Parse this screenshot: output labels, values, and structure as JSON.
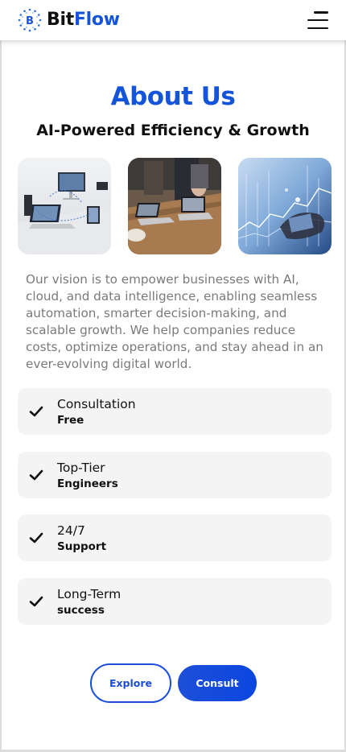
{
  "header": {
    "brand_part1": "Bit",
    "brand_part2": "Flow",
    "logo_letter": "B",
    "logo_icon": "bitflow-logo-icon",
    "menu_icon": "hamburger-menu-icon"
  },
  "about": {
    "title": "About Us",
    "subtitle": "AI-Powered Efficiency & Growth",
    "description": "Our vision is to empower businesses with AI, cloud, and data intelligence, enabling seamless automation, smarter decision-making, and scalable growth. We help companies reduce costs, optimize operations, and stay ahead in an ever-evolving digital world."
  },
  "features": [
    {
      "title": "Consultation",
      "subtitle": "Free"
    },
    {
      "title": "Top-Tier",
      "subtitle": "Engineers"
    },
    {
      "title": "24/7",
      "subtitle": "Support"
    },
    {
      "title": "Long-Term",
      "subtitle": "success"
    }
  ],
  "actions": {
    "explore_label": "Explore",
    "consult_label": "Consult"
  },
  "colors": {
    "brand_blue": "#1454d8",
    "feature_bg": "#f4f4f4",
    "text_muted": "#7a7a7a"
  }
}
